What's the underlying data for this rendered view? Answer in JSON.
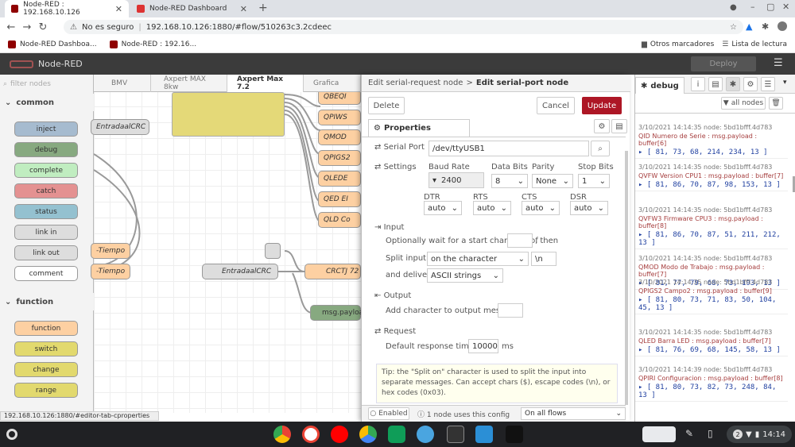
{
  "browser": {
    "tabs": [
      {
        "title": "Node-RED : 192.168.10.126"
      },
      {
        "title": "Node-RED Dashboard"
      }
    ],
    "security_label": "No es seguro",
    "url": "192.168.10.126:1880/#flow/510263c3.2cdeec",
    "bookmarks": [
      "Node-RED Dashboa...",
      "Node-RED : 192.16..."
    ],
    "other_bookmarks": "Otros marcadores",
    "reading_list": "Lista de lectura"
  },
  "nodered": {
    "title": "Node-RED",
    "deploy": "Deploy",
    "palette": {
      "filter_placeholder": "filter nodes",
      "categories": [
        "common",
        "function"
      ],
      "common_nodes": [
        "inject",
        "debug",
        "complete",
        "catch",
        "status",
        "link in",
        "link out",
        "comment"
      ],
      "function_nodes": [
        "function",
        "switch",
        "change",
        "range"
      ]
    },
    "workspace_tabs": [
      "BMV",
      "Axpert MAX 8kw",
      "Axpert Max 7.2",
      "Grafica"
    ],
    "canvas_nodes": {
      "f1": "QBEQI",
      "f2": "QPIWS",
      "f3": "QMOD",
      "f4": "QPIGS2",
      "f5": "QLEDE",
      "f6": "QED EI",
      "f7": "QLD Co",
      "crc1": "EntradaalCRC",
      "tiempo1": "-Tiempo",
      "tiempo2": "-Tiempo",
      "crc2": "EntradaalCRC",
      "crctj": "CRCTJ 72",
      "msgpayload": "msg.payloa"
    }
  },
  "editor": {
    "breadcrumb_prev": "Edit serial-request node",
    "breadcrumb_sep": ">",
    "breadcrumb_cur": "Edit serial-port node",
    "delete": "Delete",
    "cancel": "Cancel",
    "update": "Update",
    "properties_tab": "Properties",
    "serial_port_label": "Serial Port",
    "serial_port_value": "/dev/ttyUSB1",
    "settings_label": "Settings",
    "baud_label": "Baud Rate",
    "baud_value": "2400",
    "databits_label": "Data Bits",
    "databits_value": "8",
    "parity_label": "Parity",
    "parity_value": "None",
    "stopbits_label": "Stop Bits",
    "stopbits_value": "1",
    "dtr_label": "DTR",
    "dtr_value": "auto",
    "rts_label": "RTS",
    "rts_value": "auto",
    "cts_label": "CTS",
    "cts_value": "auto",
    "dsr_label": "DSR",
    "dsr_value": "auto",
    "input_label": "Input",
    "wait_text": "Optionally wait for a start character of",
    "wait_then": ", then",
    "split_label": "Split input",
    "split_value": "on the character",
    "split_char": "\\n",
    "deliver_label": "and deliver",
    "deliver_value": "ASCII strings",
    "output_label": "Output",
    "add_char_label": "Add character to output messages",
    "request_label": "Request",
    "timeout_label": "Default response timeout",
    "timeout_value": "10000",
    "timeout_unit": "ms",
    "tip": "Tip: the \"Split on\" character is used to split the input into separate messages. Can accept chars ($), escape codes (\\n), or hex codes (0x03).",
    "enabled": "Enabled",
    "uses": "1 node uses this config",
    "scope": "On all flows"
  },
  "sidebar": {
    "title": "debug",
    "filter": "all nodes",
    "messages": [
      {
        "meta": "3/10/2021 14:14:35  node: 5bd1bfff.4d783",
        "topic": "QID Numero de Serie : msg.payload : buffer[6]",
        "value": "[ 81, 73, 68, 214, 234, 13 ]"
      },
      {
        "meta": "3/10/2021 14:14:35  node: 5bd1bfff.4d783",
        "topic": "QVFW Version CPU1 : msg.payload : buffer[7]",
        "value": "[ 81, 86, 70, 87, 98, 153, 13 ]"
      },
      {
        "meta": "3/10/2021 14:14:35  node: 5bd1bfff.4d783",
        "topic": "QVFW3 Firmware CPU3 : msg.payload : buffer[8]",
        "value": "[ 81, 86, 70, 87, 51, 211, 212, 13 ]"
      },
      {
        "meta": "3/10/2021 14:14:35  node: 5bd1bfff.4d783",
        "topic": "QMOD Modo de Trabajo : msg.payload : buffer[7]",
        "value": "[ 81, 77, 79, 68, 73, 193, 13 ]"
      },
      {
        "meta": "3/10/2021 14:14:35  node: 5bd1bfff.4d783",
        "topic": "QPIGS2 Campo2 : msg.payload : buffer[9]",
        "value": "[ 81, 80, 73, 71, 83, 50, 104, 45, 13 ]"
      },
      {
        "meta": "3/10/2021 14:14:35  node: 5bd1bfff.4d783",
        "topic": "QLED Barra LED : msg.payload : buffer[7]",
        "value": "[ 81, 76, 69, 68, 145, 58, 13 ]"
      },
      {
        "meta": "3/10/2021 14:14:39  node: 5bd1bfff.4d783",
        "topic": "QPIRI Configuracion : msg.payload : buffer[8]",
        "value": "[ 81, 80, 73, 82, 73, 248, 84, 13 ]"
      }
    ]
  },
  "statusbar_url": "192.168.10.126:1880/#editor-tab-cproperties",
  "shelf": {
    "badge": "2",
    "time": "14:14"
  }
}
